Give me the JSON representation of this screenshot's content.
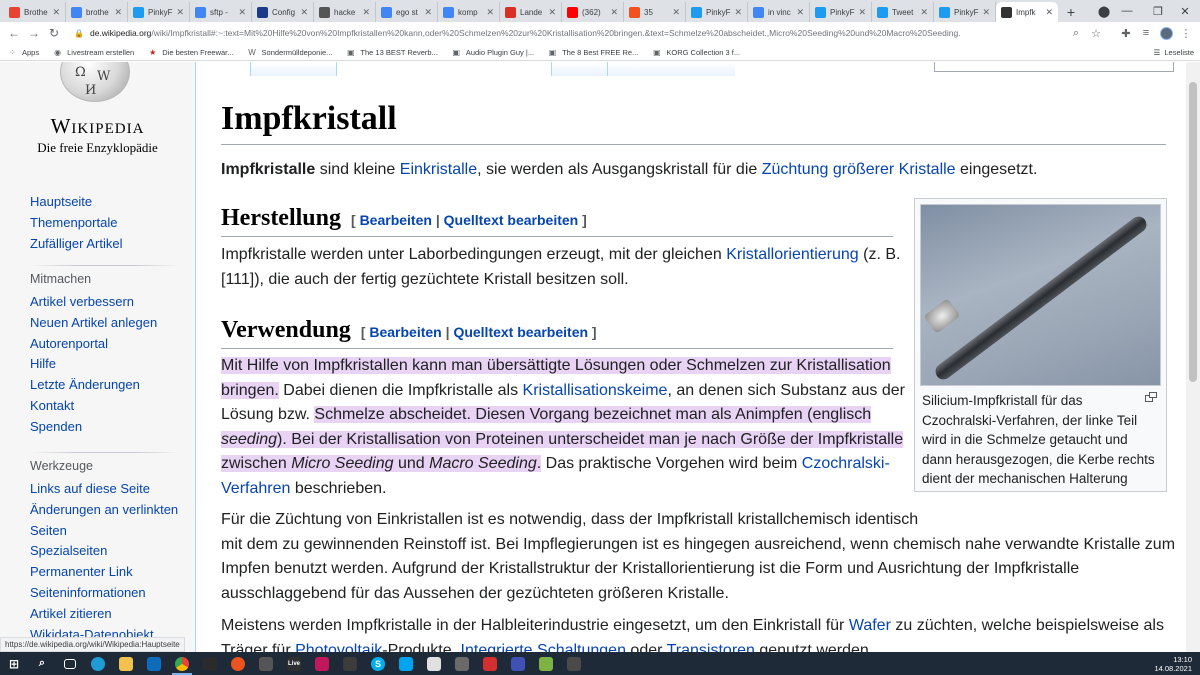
{
  "browser": {
    "tabs": [
      {
        "label": "Brothe",
        "color": "#e94235"
      },
      {
        "label": "brothe",
        "color": "#4285f4"
      },
      {
        "label": "PinkyF",
        "color": "#1d9bf0"
      },
      {
        "label": "sftp -",
        "color": "#4285f4"
      },
      {
        "label": "Config",
        "color": "#1a3b8a"
      },
      {
        "label": "hacke",
        "color": "#555555"
      },
      {
        "label": "ego st",
        "color": "#4285f4"
      },
      {
        "label": "komp",
        "color": "#4285f4"
      },
      {
        "label": "Lande",
        "color": "#d93025"
      },
      {
        "label": "(362)",
        "color": "#ff0000"
      },
      {
        "label": "35",
        "color": "#f4511e"
      },
      {
        "label": "PinkyF",
        "color": "#1d9bf0"
      },
      {
        "label": "in vinc",
        "color": "#4285f4"
      },
      {
        "label": "PinkyF",
        "color": "#1d9bf0"
      },
      {
        "label": "Tweet",
        "color": "#1d9bf0"
      },
      {
        "label": "PinkyF",
        "color": "#1d9bf0"
      },
      {
        "label": "Impfk",
        "color": "#333333"
      }
    ],
    "url_host": "de.wikipedia.org",
    "url_path": "/wiki/Impfkristall#:~:text=Mit%20Hilfe%20von%20Impfkristallen%20kann,oder%20Schmelzen%20zur%20Kristallisation%20bringen.&text=Schmelze%20abscheidet.,Micro%20Seeding%20und%20Macro%20Seeding.",
    "bookmarks": [
      {
        "label": "Apps",
        "icon": "apps-grid-icon"
      },
      {
        "label": "Livestream erstellen",
        "icon": "globe-icon"
      },
      {
        "label": "Die besten Freewar...",
        "icon": "star-icon"
      },
      {
        "label": "Sondermülldeponie...",
        "icon": "w-icon"
      },
      {
        "label": "The 13 BEST Reverb...",
        "icon": "page-icon"
      },
      {
        "label": "Audio Plugin Guy |...",
        "icon": "page-icon"
      },
      {
        "label": "The 8 Best FREE Re...",
        "icon": "page-icon"
      },
      {
        "label": "KORG Collection 3 f...",
        "icon": "page-icon"
      }
    ],
    "reading_list": "Leseliste",
    "status_url": "https://de.wikipedia.org/wiki/Wikipedia:Hauptseite"
  },
  "logo": {
    "wordmark": "Wikipedia",
    "tagline": "Die freie Enzyklopädie"
  },
  "nav": {
    "main": [
      "Hauptseite",
      "Themenportale",
      "Zufälliger Artikel"
    ],
    "mitmachen_heading": "Mitmachen",
    "mitmachen": [
      "Artikel verbessern",
      "Neuen Artikel anlegen",
      "Autorenportal",
      "Hilfe",
      "Letzte Änderungen",
      "Kontakt",
      "Spenden"
    ],
    "werkzeuge_heading": "Werkzeuge",
    "werkzeuge": [
      "Links auf diese Seite",
      "Änderungen an verlinkten Seiten",
      "Spezialseiten",
      "Permanenter Link",
      "Seiteninformationen",
      "Artikel zitieren",
      "Wikidata-Datenobjekt"
    ]
  },
  "article": {
    "title": "Impfkristall",
    "intro": {
      "bold": "Impfkristalle",
      "t1": " sind kleine ",
      "l1": "Einkristalle",
      "t2": ", sie werden als Ausgangskristall für die ",
      "l2": "Züchtung größerer Kristalle",
      "t3": " eingesetzt."
    },
    "edit": {
      "open": "[",
      "edit": "Bearbeiten",
      "sep": "|",
      "source": "Quelltext bearbeiten",
      "close": "]"
    },
    "herstellung": {
      "heading": "Herstellung",
      "t1": "Impfkristalle werden unter Laborbedingungen erzeugt, mit der gleichen ",
      "l1": "Kristallorientierung",
      "t2": " (z. B.",
      "t3": "[111]), die auch der fertig gezüchtete Kristall besitzen soll."
    },
    "verwendung": {
      "heading": "Verwendung",
      "p1_hl1a": "Mit Hilfe von Impfkristallen kann man übersättigte Lösungen oder Schmelzen zur Kristallisation",
      "p1_hl1b": "bringen.",
      "p1_t1": " Dabei dienen die Impfkristalle als ",
      "p1_l1": "Kristallisationskeime",
      "p1_t2": ", an denen sich Substanz aus der",
      "p1_t3": "Lösung bzw. ",
      "p1_hl2a": "Schmelze abscheidet. Diesen Vorgang bezeichnet man als Animpfen (englisch",
      "p1_hl2b_i": "seeding",
      "p1_hl2b": "). Bei der Kristallisation von Proteinen unterscheidet man je nach Größe der Impfkristalle",
      "p1_hl2c": "zwischen ",
      "p1_hl2c_i1": "Micro Seeding",
      "p1_hl2c_und": " und ",
      "p1_hl2c_i2": "Macro Seeding",
      "p1_hl2c_end": ".",
      "p1_t4": " Das praktische Vorgehen wird beim ",
      "p1_l2a": "Czochralski-",
      "p1_l2b": "Verfahren",
      "p1_t5": " beschrieben.",
      "p2_l1": "Für die Züchtung von Einkristallen ist es notwendig, dass der Impfkristall kristallchemisch identisch",
      "p2_l2": "mit dem zu gewinnenden Reinstoff ist. Bei Impflegierungen ist es hingegen ausreichend, wenn chemisch nahe verwandte Kristalle zum",
      "p2_l3": "Impfen benutzt werden. Aufgrund der Kristallstruktur der Kristallorientierung ist die Form und Ausrichtung der Impfkristalle",
      "p2_l4": "ausschlaggebend für das Aussehen der gezüchteten größeren Kristalle.",
      "p3_t1": "Meistens werden Impfkristalle in der Halbleiterindustrie eingesetzt, um den Einkristall für ",
      "p3_l1": "Wafer",
      "p3_t2": " zu züchten, welche beispielsweise als",
      "p3_t3": "Träger für ",
      "p3_l2": "Photovoltaik",
      "p3_t4": "-Produkte, ",
      "p3_l3": "Integrierte Schaltungen",
      "p3_t5": " oder ",
      "p3_l4": "Transistoren",
      "p3_t6": " genutzt werden."
    },
    "figure_caption": "Silicium-Impfkristall für das Czochralski-Verfahren, der linke Teil wird in die Schmelze getaucht und dann herausgezogen, die Kerbe rechts dient der mechanischen Halterung"
  },
  "taskbar": {
    "time": "13:10",
    "date": "14.08.2021"
  }
}
